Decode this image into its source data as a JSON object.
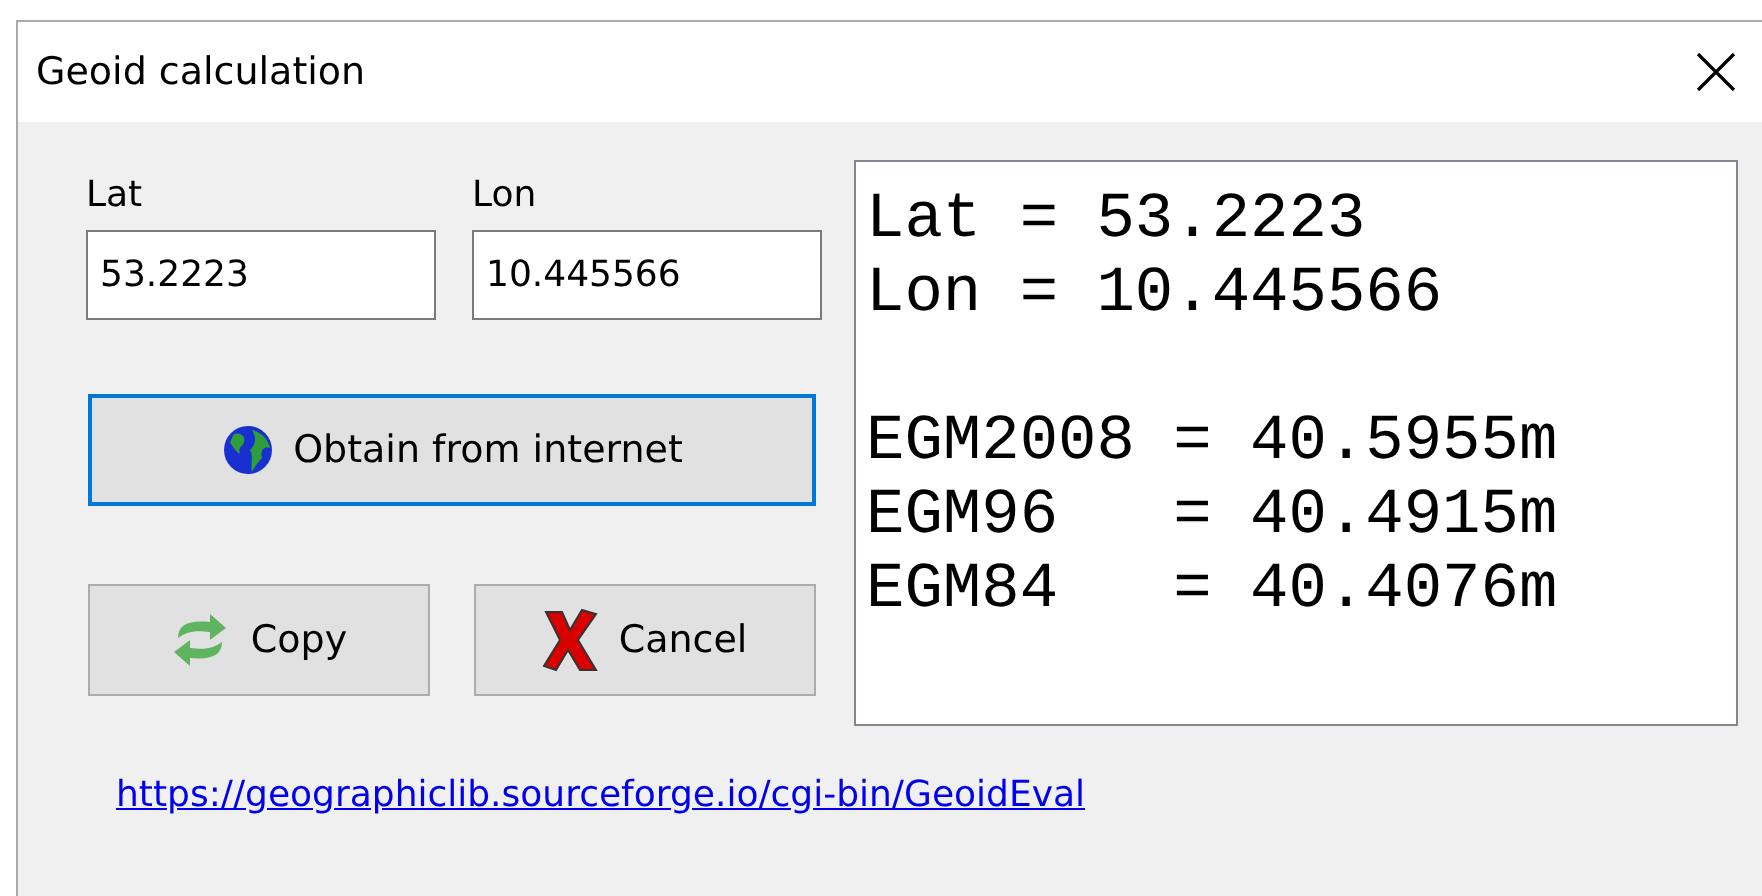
{
  "window": {
    "title": "Geoid calculation"
  },
  "fields": [
    {
      "label": "Lat",
      "value": "53.2223"
    },
    {
      "label": "Lon",
      "value": "10.445566"
    }
  ],
  "obtain_button": {
    "label": "Obtain from internet",
    "focused": true
  },
  "buttons": [
    {
      "kind": "copy",
      "label": "Copy"
    },
    {
      "kind": "cancel",
      "label": "Cancel"
    }
  ],
  "link": "https://geographiclib.sourceforge.io/cgi-bin/GeoidEval",
  "output": {
    "blocks": [
      [
        "Lat = 53.2223",
        "Lon = 10.445566"
      ],
      [
        "EGM2008 = 40.5955m",
        "EGM96   = 40.4915m",
        "EGM84   = 40.4076m"
      ]
    ]
  }
}
